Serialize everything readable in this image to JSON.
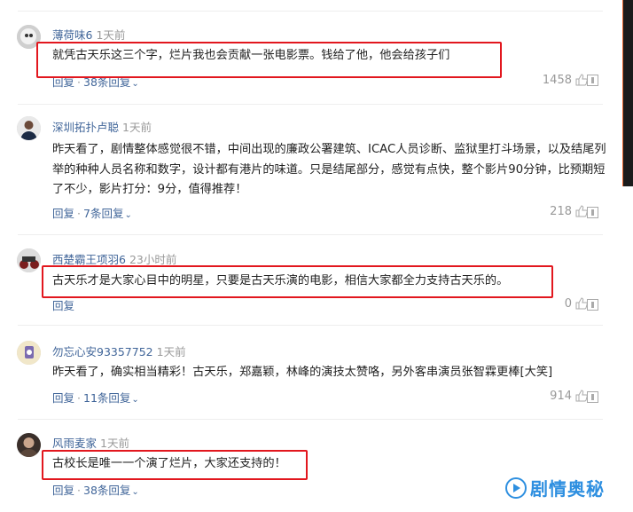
{
  "comments": [
    {
      "username": "薄荷味6",
      "time": "1天前",
      "body": "就凭古天乐这三个字，烂片我也会贡献一张电影票。钱给了他，他会给孩子们",
      "reply": "回复",
      "replies_link": "38条回复",
      "likes": "1458",
      "highlighted": true
    },
    {
      "username": "深圳拓扑卢聪",
      "time": "1天前",
      "body": "昨天看了，剧情整体感觉很不错，中间出现的廉政公署建筑、ICAC人员诊断、监狱里打斗场景，以及结尾列举的种种人员名称和数字，设计都有港片的味道。只是结尾部分，感觉有点快，整个影片90分钟，比预期短了不少，影片打分：9分，值得推荐！",
      "reply": "回复",
      "replies_link": "7条回复",
      "likes": "218",
      "highlighted": false
    },
    {
      "username": "西楚霸王项羽6",
      "time": "23小时前",
      "body": "古天乐才是大家心目中的明星，只要是古天乐演的电影，相信大家都全力支持古天乐的。",
      "reply": "回复",
      "replies_link": "",
      "likes": "0",
      "highlighted": true
    },
    {
      "username": "勿忘心安93357752",
      "time": "1天前",
      "body": "昨天看了，确实相当精彩！古天乐，郑嘉颖，林峰的演技太赞咯，另外客串演员张智霖更棒[大笑]",
      "reply": "回复",
      "replies_link": "11条回复",
      "likes": "914",
      "highlighted": false
    },
    {
      "username": "风雨麦家",
      "time": "1天前",
      "body": "古校长是唯一一个演了烂片，大家还支持的！",
      "reply": "回复",
      "replies_link": "38条回复",
      "likes": "",
      "highlighted": true
    }
  ],
  "watermark": {
    "text": "剧情奥秘"
  },
  "colors": {
    "username": "#406599",
    "highlight_border": "#e2171e",
    "watermark": "#2e8fe0"
  }
}
